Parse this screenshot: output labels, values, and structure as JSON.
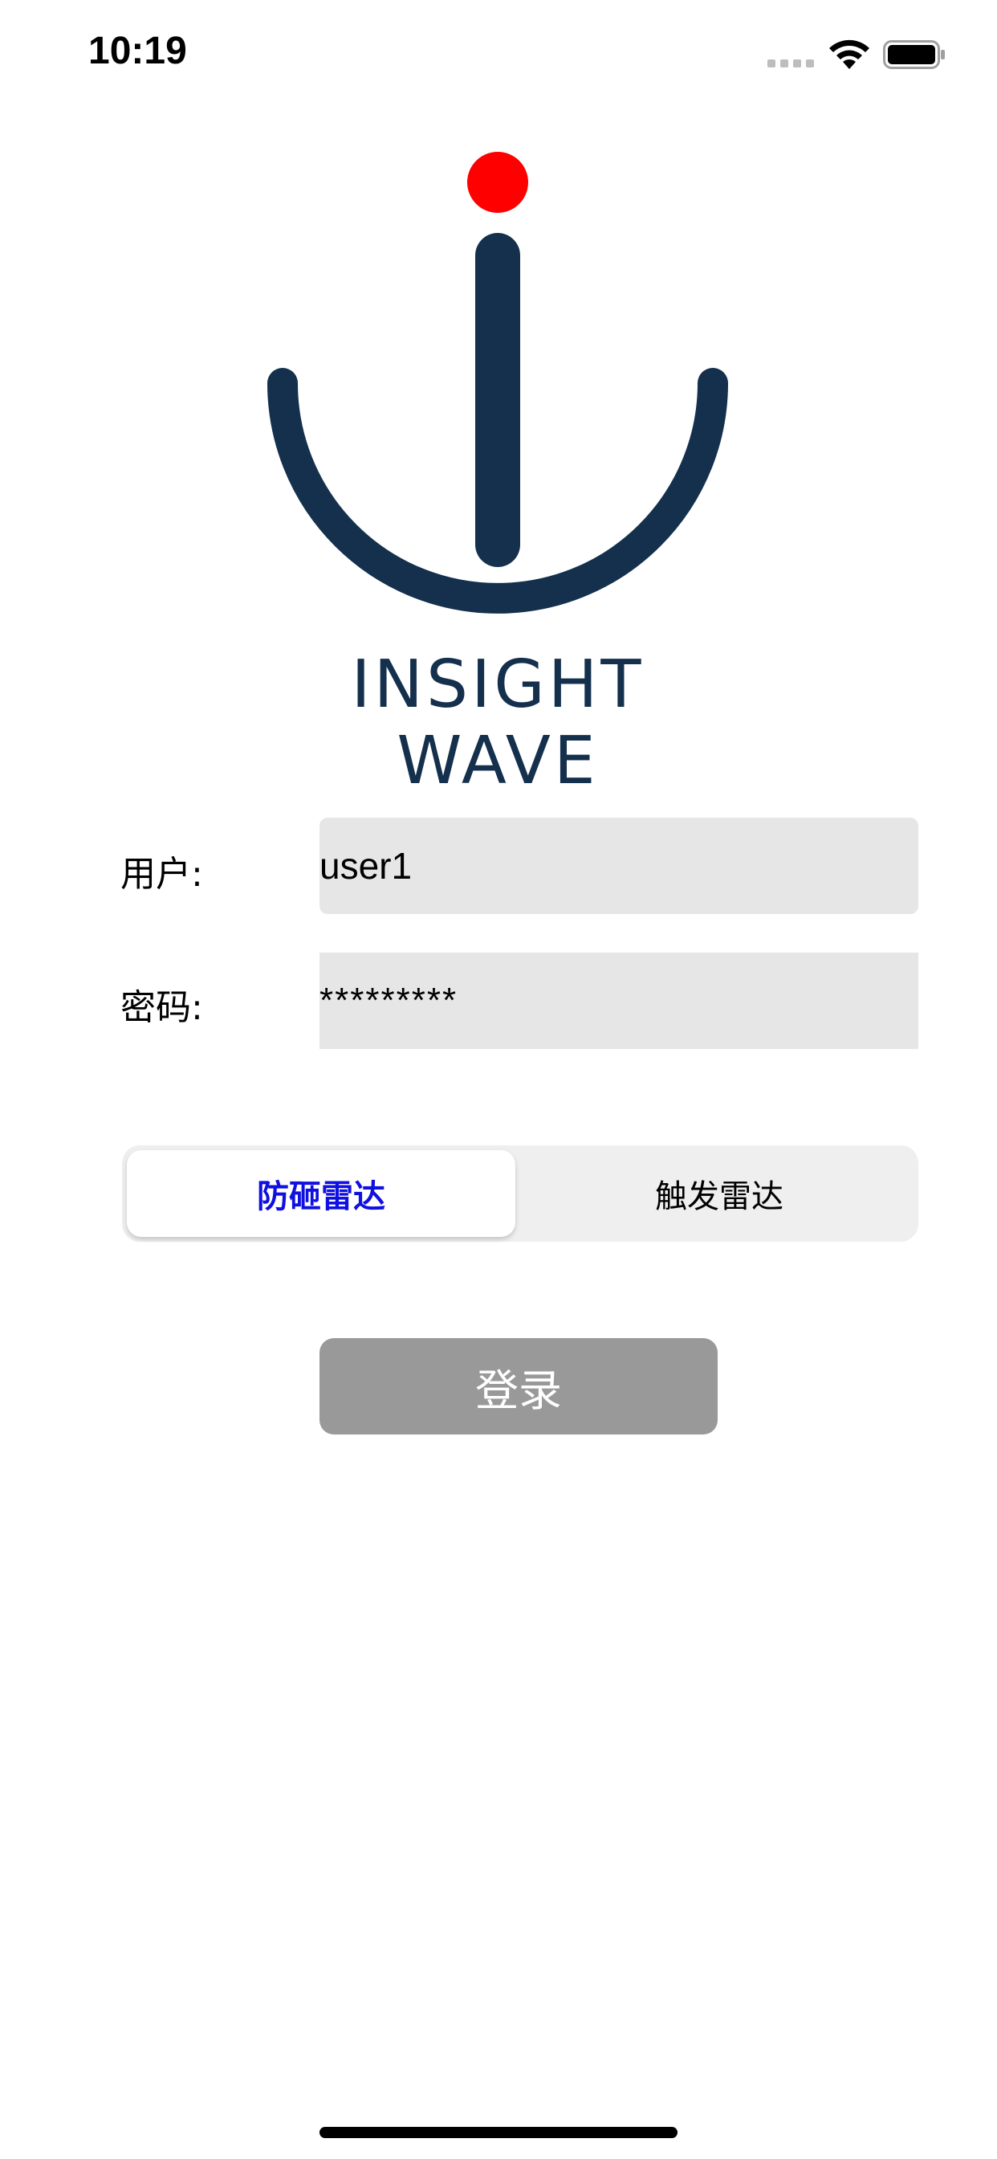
{
  "status_bar": {
    "time": "10:19",
    "icons": [
      "cellular-signal-icon",
      "wifi-icon",
      "battery-icon"
    ]
  },
  "brand": {
    "name": "INSIGHT WAVE",
    "colors": {
      "navy": "#14304d",
      "dot": "#ff0000"
    }
  },
  "form": {
    "username": {
      "label": "用户:",
      "value": "user1"
    },
    "password": {
      "label": "密码:",
      "value": "*********"
    }
  },
  "radar_type": {
    "options": [
      "防砸雷达",
      "触发雷达"
    ],
    "selected": "防砸雷达",
    "selected_color": "#1010e0"
  },
  "login": {
    "label": "登录",
    "color": "#999999"
  }
}
